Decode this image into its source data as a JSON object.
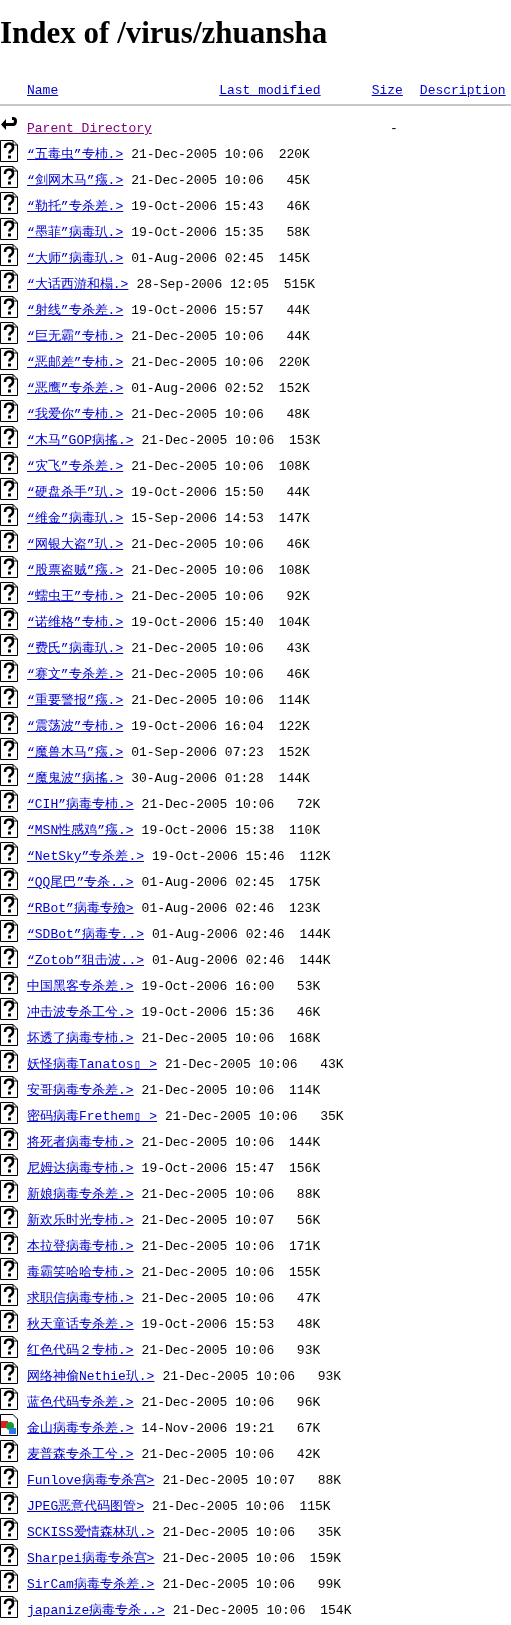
{
  "title": "Index of /virus/zhuansha",
  "columns": [
    {
      "label": "Name"
    },
    {
      "label": "Last modified"
    },
    {
      "label": "Size"
    },
    {
      "label": "Description"
    }
  ],
  "entries": [
    {
      "kind": "back",
      "name": "Parent Directory",
      "visited": true,
      "size": "-"
    },
    {
      "kind": "unknown",
      "name": "“五毒虫”专杮.>",
      "visited": false,
      "modified": "21-Dec-2005 10:06",
      "size": "220K"
    },
    {
      "kind": "unknown",
      "name": "“剑网木马”瘬.>",
      "visited": false,
      "modified": "21-Dec-2005 10:06",
      "size": "45K"
    },
    {
      "kind": "unknown",
      "name": "“勒托”专杀差.>",
      "visited": false,
      "modified": "19-Oct-2006 15:43",
      "size": "46K"
    },
    {
      "kind": "unknown",
      "name": "“墨菲”病毒玐.>",
      "visited": false,
      "modified": "19-Oct-2006 15:35",
      "size": "58K"
    },
    {
      "kind": "unknown",
      "name": "“大师”病毒玐.>",
      "visited": false,
      "modified": "01-Aug-2006 02:45",
      "size": "145K"
    },
    {
      "kind": "unknown",
      "name": "“大话西游和榻.>",
      "visited": false,
      "modified": "28-Sep-2006 12:05",
      "size": "515K"
    },
    {
      "kind": "unknown",
      "name": "“射线”专杀差.>",
      "visited": false,
      "modified": "19-Oct-2006 15:57",
      "size": "44K"
    },
    {
      "kind": "unknown",
      "name": "“巨无霸”专杮.>",
      "visited": false,
      "modified": "21-Dec-2005 10:06",
      "size": "44K"
    },
    {
      "kind": "unknown",
      "name": "“恶邮差”专杮.>",
      "visited": false,
      "modified": "21-Dec-2005 10:06",
      "size": "220K"
    },
    {
      "kind": "unknown",
      "name": "“恶鹰”专杀差.>",
      "visited": false,
      "modified": "01-Aug-2006 02:52",
      "size": "152K"
    },
    {
      "kind": "unknown",
      "name": "“我爱你”专杮.>",
      "visited": false,
      "modified": "21-Dec-2005 10:06",
      "size": "48K"
    },
    {
      "kind": "unknown",
      "name": "“木马”GOP病搖.>",
      "visited": false,
      "modified": "21-Dec-2005 10:06",
      "size": "153K"
    },
    {
      "kind": "unknown",
      "name": "“灾飞”专杀差.>",
      "visited": false,
      "modified": "21-Dec-2005 10:06",
      "size": "108K"
    },
    {
      "kind": "unknown",
      "name": "“硬盘杀手”玐.>",
      "visited": false,
      "modified": "19-Oct-2006 15:50",
      "size": "44K"
    },
    {
      "kind": "unknown",
      "name": "“维金”病毒玐.>",
      "visited": false,
      "modified": "15-Sep-2006 14:53",
      "size": "147K"
    },
    {
      "kind": "unknown",
      "name": "“网银大盗”玐.>",
      "visited": false,
      "modified": "21-Dec-2005 10:06",
      "size": "46K"
    },
    {
      "kind": "unknown",
      "name": "“股票盗贼”瘬.>",
      "visited": false,
      "modified": "21-Dec-2005 10:06",
      "size": "108K"
    },
    {
      "kind": "unknown",
      "name": "“蠕虫王”专杮.>",
      "visited": false,
      "modified": "21-Dec-2005 10:06",
      "size": "92K"
    },
    {
      "kind": "unknown",
      "name": "“诺维格”专杮.>",
      "visited": false,
      "modified": "19-Oct-2006 15:40",
      "size": "104K"
    },
    {
      "kind": "unknown",
      "name": "“费氏”病毒玐.>",
      "visited": false,
      "modified": "21-Dec-2005 10:06",
      "size": "43K"
    },
    {
      "kind": "unknown",
      "name": "“赛文”专杀差.>",
      "visited": false,
      "modified": "21-Dec-2005 10:06",
      "size": "46K"
    },
    {
      "kind": "unknown",
      "name": "“重要警报”瘬.>",
      "visited": false,
      "modified": "21-Dec-2005 10:06",
      "size": "114K"
    },
    {
      "kind": "unknown",
      "name": "“震荡波”专杮.>",
      "visited": false,
      "modified": "19-Oct-2006 16:04",
      "size": "122K"
    },
    {
      "kind": "unknown",
      "name": "“魔兽木马”瘬.>",
      "visited": false,
      "modified": "01-Sep-2006 07:23",
      "size": "152K"
    },
    {
      "kind": "unknown",
      "name": "“魔鬼波”病搖.>",
      "visited": false,
      "modified": "30-Aug-2006 01:28",
      "size": "144K"
    },
    {
      "kind": "unknown",
      "name": "“CIH”病毒专杮.>",
      "visited": false,
      "modified": "21-Dec-2005 10:06",
      "size": "72K"
    },
    {
      "kind": "unknown",
      "name": "“MSN性感鸡”瘬.>",
      "visited": false,
      "modified": "19-Oct-2006 15:38",
      "size": "110K"
    },
    {
      "kind": "unknown",
      "name": "“NetSky”专杀差.>",
      "visited": false,
      "modified": "19-Oct-2006 15:46",
      "size": "112K"
    },
    {
      "kind": "unknown",
      "name": "“QQ尾巴”专杀..>",
      "visited": false,
      "modified": "01-Aug-2006 02:45",
      "size": "175K"
    },
    {
      "kind": "unknown",
      "name": "“RBot”病毒专殮>",
      "visited": false,
      "modified": "01-Aug-2006 02:46",
      "size": "123K"
    },
    {
      "kind": "unknown",
      "name": "“SDBot”病毒专..>",
      "visited": false,
      "modified": "01-Aug-2006 02:46",
      "size": "144K"
    },
    {
      "kind": "unknown",
      "name": "“Zotob”狙击波..>",
      "visited": false,
      "modified": "01-Aug-2006 02:46",
      "size": "144K"
    },
    {
      "kind": "unknown",
      "name": "中国黑客专杀差.>",
      "visited": false,
      "modified": "19-Oct-2006 16:00",
      "size": "53K"
    },
    {
      "kind": "unknown",
      "name": "冲击波专杀工兮.>",
      "visited": false,
      "modified": "19-Oct-2006 15:36",
      "size": "46K"
    },
    {
      "kind": "unknown",
      "name": "坏透了病毒专杮.>",
      "visited": false,
      "modified": "21-Dec-2005 10:06",
      "size": "168K"
    },
    {
      "kind": "unknown",
      "name": "妖怪病毒Tanatos▯ >",
      "visited": false,
      "modified": "21-Dec-2005 10:06",
      "size": "43K"
    },
    {
      "kind": "unknown",
      "name": "安哥病毒专杀差.>",
      "visited": false,
      "modified": "21-Dec-2005 10:06",
      "size": "114K"
    },
    {
      "kind": "unknown",
      "name": "密码病毒Frethem▯ >",
      "visited": false,
      "modified": "21-Dec-2005 10:06",
      "size": "35K"
    },
    {
      "kind": "unknown",
      "name": "将死者病毒专杮.>",
      "visited": false,
      "modified": "21-Dec-2005 10:06",
      "size": "144K"
    },
    {
      "kind": "unknown",
      "name": "尼姆达病毒专杮.>",
      "visited": false,
      "modified": "19-Oct-2006 15:47",
      "size": "156K"
    },
    {
      "kind": "unknown",
      "name": "新娘病毒专杀差.>",
      "visited": false,
      "modified": "21-Dec-2005 10:06",
      "size": "88K"
    },
    {
      "kind": "unknown",
      "name": "新欢乐时光专杮.>",
      "visited": false,
      "modified": "21-Dec-2005 10:07",
      "size": "56K"
    },
    {
      "kind": "unknown",
      "name": "本拉登病毒专杮.>",
      "visited": false,
      "modified": "21-Dec-2005 10:06",
      "size": "171K"
    },
    {
      "kind": "unknown",
      "name": "毒霸笑哈哈专杮.>",
      "visited": false,
      "modified": "21-Dec-2005 10:06",
      "size": "155K"
    },
    {
      "kind": "unknown",
      "name": "求职信病毒专杮.>",
      "visited": false,
      "modified": "21-Dec-2005 10:06",
      "size": "47K"
    },
    {
      "kind": "unknown",
      "name": "秋天童话专杀差.>",
      "visited": false,
      "modified": "19-Oct-2006 15:53",
      "size": "48K"
    },
    {
      "kind": "unknown",
      "name": "红色代码２专杮.>",
      "visited": false,
      "modified": "21-Dec-2005 10:06",
      "size": "93K"
    },
    {
      "kind": "unknown",
      "name": "网络神偷Nethie玐.>",
      "visited": false,
      "modified": "21-Dec-2005 10:06",
      "size": "93K"
    },
    {
      "kind": "unknown",
      "name": "蓝色代码专杀差.>",
      "visited": false,
      "modified": "21-Dec-2005 10:06",
      "size": "96K"
    },
    {
      "kind": "image",
      "name": "金山病毒专杀差.>",
      "visited": false,
      "modified": "14-Nov-2006 19:21",
      "size": "67K"
    },
    {
      "kind": "unknown",
      "name": "麦普森专杀工兮.>",
      "visited": false,
      "modified": "21-Dec-2005 10:06",
      "size": "42K"
    },
    {
      "kind": "unknown",
      "name": "Funlove病毒专杀宫>",
      "visited": false,
      "modified": "21-Dec-2005 10:07",
      "size": "88K"
    },
    {
      "kind": "unknown",
      "name": "JPEG恶意代码图管>",
      "visited": false,
      "modified": "21-Dec-2005 10:06",
      "size": "115K"
    },
    {
      "kind": "unknown",
      "name": "SCKISS爱情森林玐.>",
      "visited": false,
      "modified": "21-Dec-2005 10:06",
      "size": "35K"
    },
    {
      "kind": "unknown",
      "name": "Sharpei病毒专杀宫>",
      "visited": false,
      "modified": "21-Dec-2005 10:06",
      "size": "159K"
    },
    {
      "kind": "unknown",
      "name": "SirCam病毒专杀差.>",
      "visited": false,
      "modified": "21-Dec-2005 10:06",
      "size": "99K"
    },
    {
      "kind": "unknown",
      "name": "japanize病毒专杀..>",
      "visited": false,
      "modified": "21-Dec-2005 10:06",
      "size": "154K"
    }
  ]
}
